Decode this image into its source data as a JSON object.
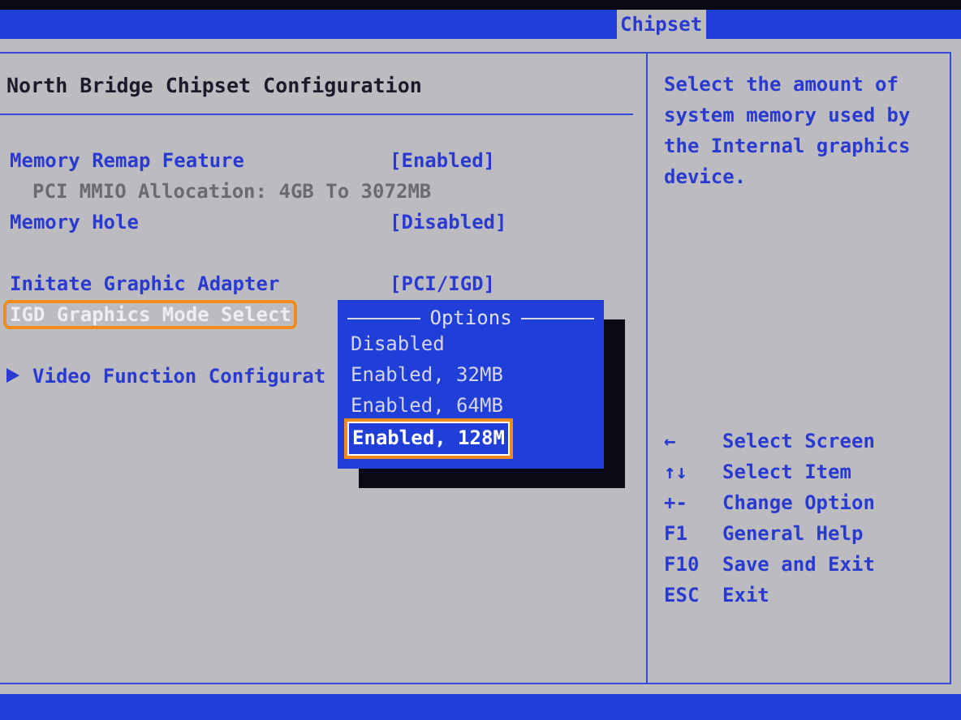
{
  "tabs": [
    {
      "label": "Chipset",
      "selected": true
    }
  ],
  "section_title": "North Bridge Chipset Configuration",
  "items": [
    {
      "kind": "setting",
      "label": "Memory Remap Feature",
      "value": "[Enabled]",
      "selected": false
    },
    {
      "kind": "info",
      "label": "PCI MMIO Allocation: 4GB To 3072MB"
    },
    {
      "kind": "setting",
      "label": "Memory Hole",
      "value": "[Disabled]",
      "selected": false
    },
    {
      "kind": "gap"
    },
    {
      "kind": "setting",
      "label": "Initate Graphic Adapter",
      "value": "[PCI/IGD]",
      "selected": false
    },
    {
      "kind": "setting",
      "label": "IGD Graphics Mode Select",
      "selected": true
    },
    {
      "kind": "gap"
    },
    {
      "kind": "submenu",
      "label": "Video Function Configurat",
      "selected": false
    }
  ],
  "options_popup": {
    "title": "Options",
    "options": [
      {
        "label": "Disabled",
        "selected": false
      },
      {
        "label": "Enabled, 32MB",
        "selected": false
      },
      {
        "label": "Enabled, 64MB",
        "selected": false
      },
      {
        "label": "Enabled, 128M",
        "selected": true
      }
    ]
  },
  "help_text": "Select the amount of system memory used by the Internal graphics device.",
  "key_legend": [
    {
      "key": "←",
      "action": "Select Screen"
    },
    {
      "key": "↑↓",
      "action": "Select Item"
    },
    {
      "key": "+-",
      "action": "Change Option"
    },
    {
      "key": "F1",
      "action": "General Help"
    },
    {
      "key": "F10",
      "action": "Save and Exit"
    },
    {
      "key": "ESC",
      "action": "Exit"
    }
  ]
}
